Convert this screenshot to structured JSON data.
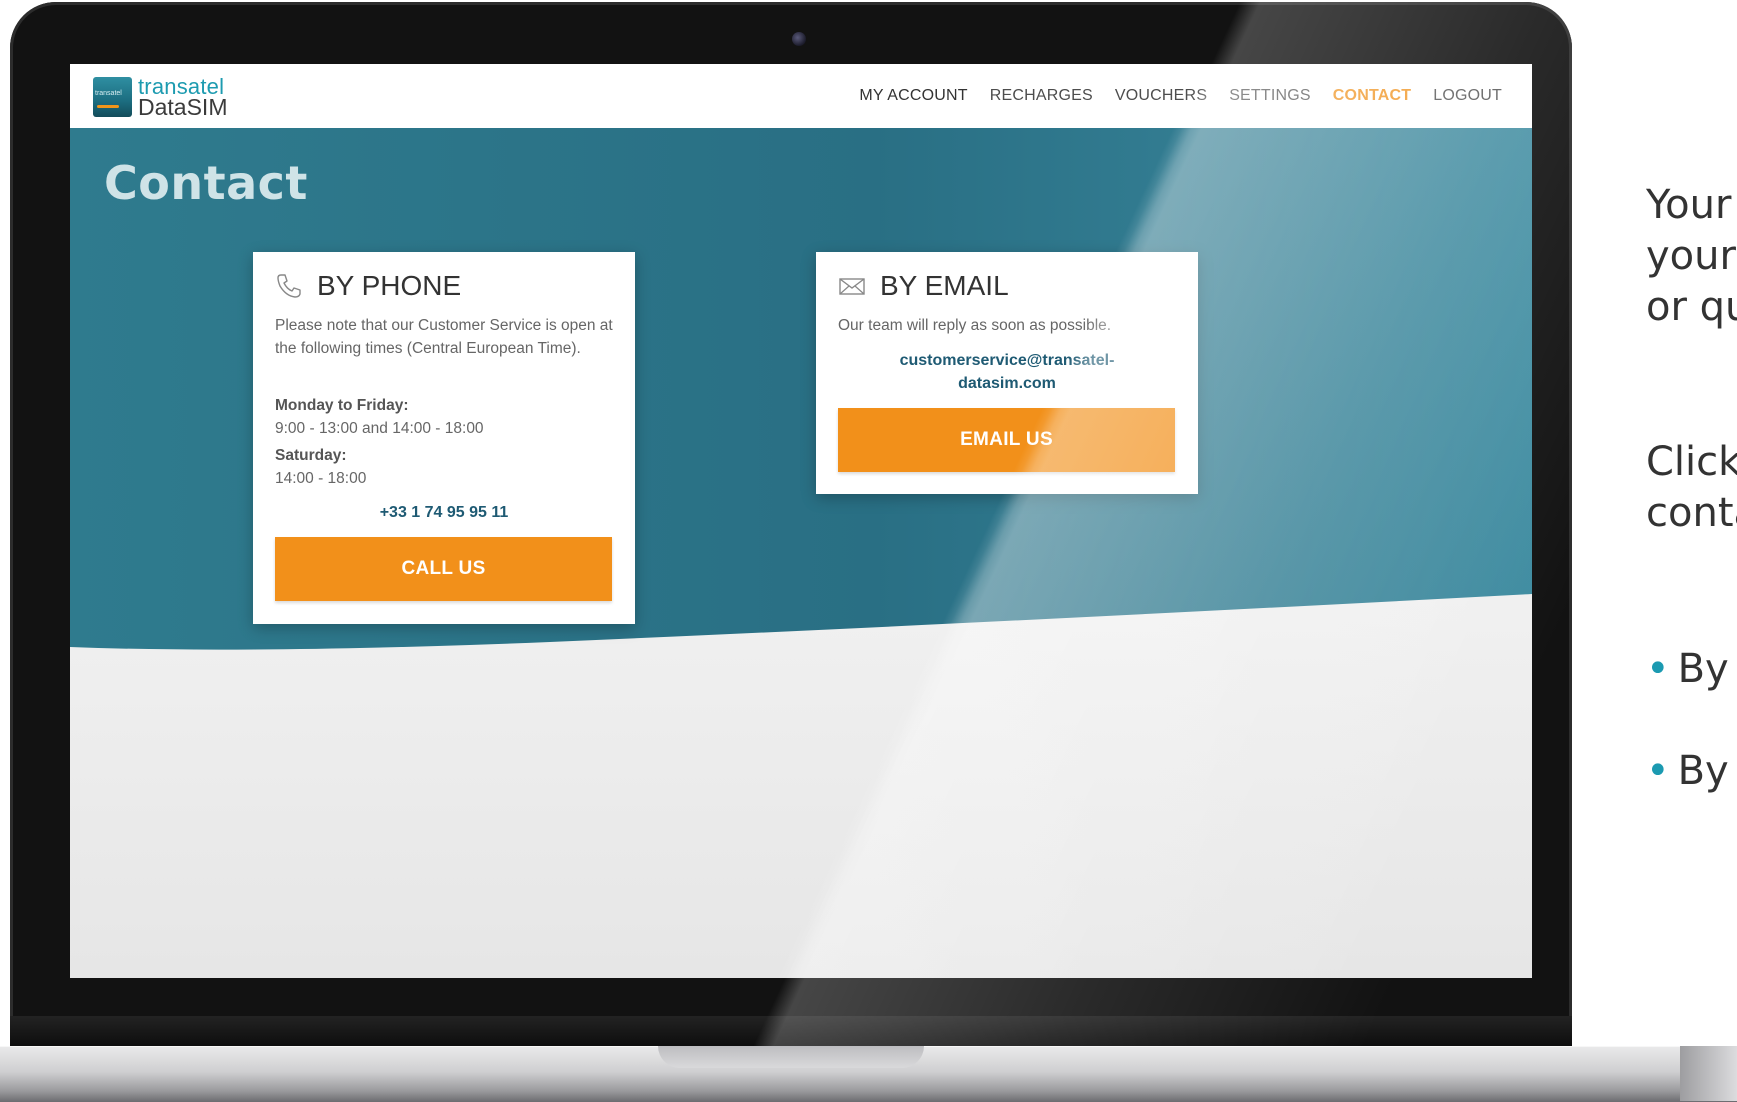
{
  "brand": {
    "logo_badge": "transatel",
    "name_line1": "transatel",
    "name_line2": "DataSIM"
  },
  "nav": {
    "items": [
      {
        "label": "MY ACCOUNT"
      },
      {
        "label": "RECHARGES"
      },
      {
        "label": "VOUCHERS"
      },
      {
        "label": "SETTINGS"
      },
      {
        "label": "CONTACT",
        "active": true
      },
      {
        "label": "LOGOUT"
      }
    ]
  },
  "page": {
    "title": "Contact"
  },
  "phone_card": {
    "icon": "phone-icon",
    "heading": "BY PHONE",
    "intro": "Please note that our Customer Service is open at the following times (Central European Time).",
    "weekday_label": "Monday to Friday:",
    "weekday_hours": "9:00 - 13:00 and 14:00 - 18:00",
    "saturday_label": "Saturday:",
    "saturday_hours": "14:00 - 18:00",
    "phone_number": "+33 1 74 95 95 11",
    "button": "CALL US"
  },
  "email_card": {
    "icon": "envelope-icon",
    "heading": "BY EMAIL",
    "intro": "Our team will reply as soon as possible.",
    "email_line1": "customerservice@transatel-",
    "email_line2": "datasim.com",
    "button": "EMAIL US"
  },
  "side_text": {
    "line1": "Your",
    "line2": "your",
    "line3": "or qu",
    "line4": "Click",
    "line5": "conta",
    "bullet1": "By p",
    "bullet2": "By e"
  },
  "colors": {
    "accent_orange": "#f2901a",
    "teal": "#2a7a8e",
    "link_blue": "#1e5a73"
  }
}
